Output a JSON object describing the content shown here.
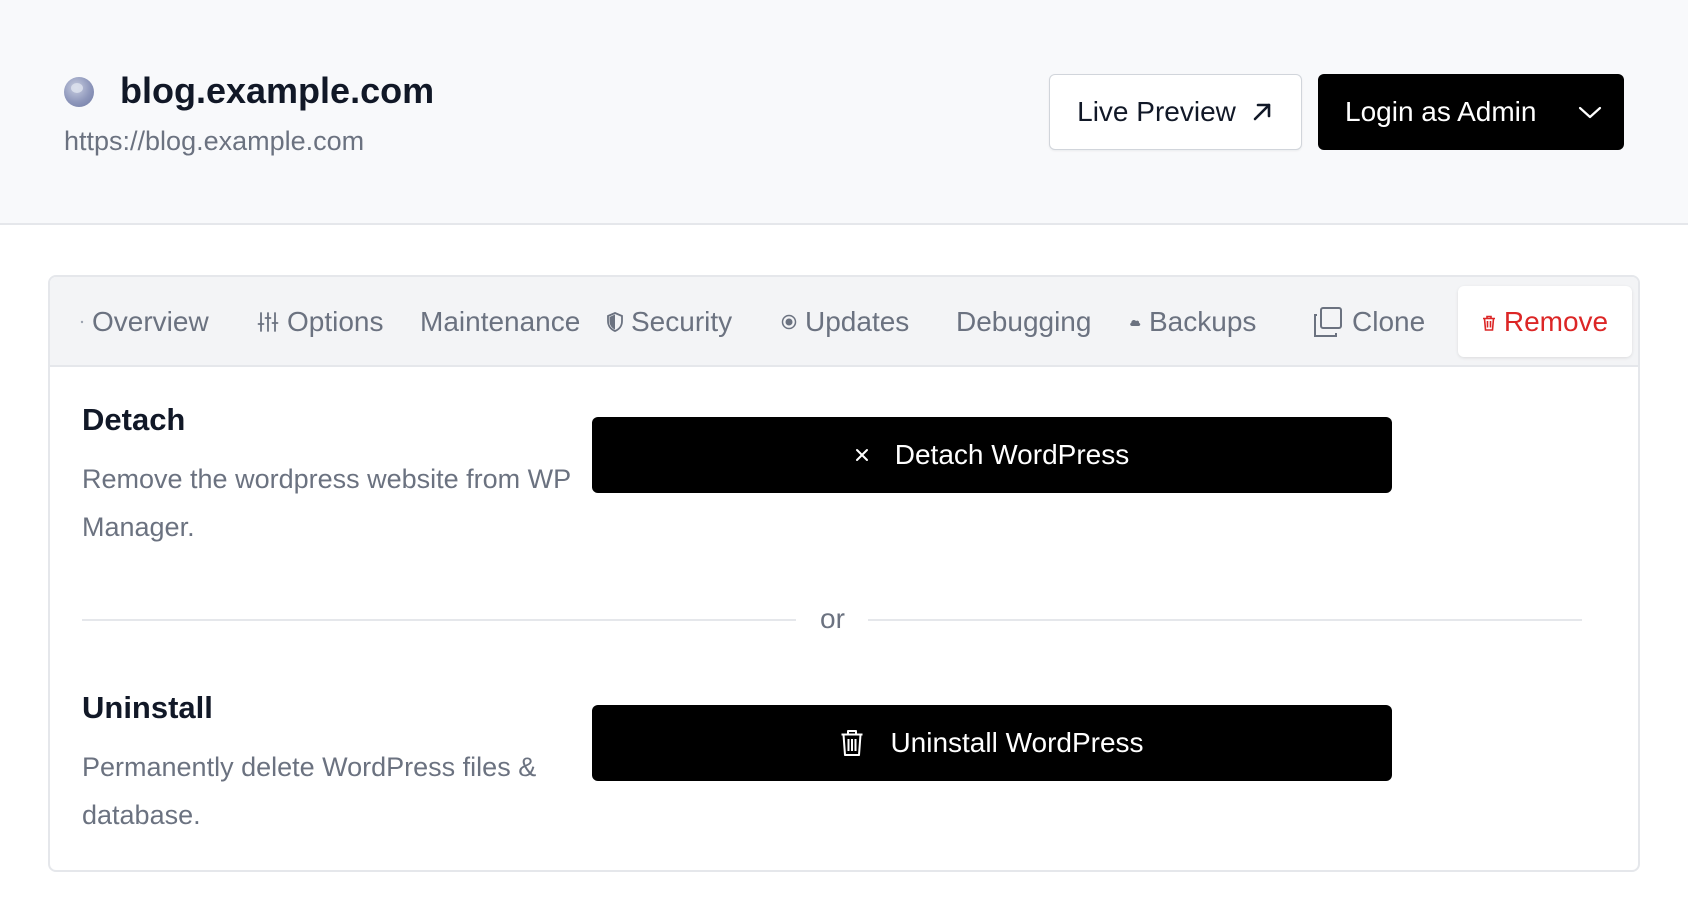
{
  "site": {
    "title": "blog.example.com",
    "url": "https://blog.example.com",
    "icon": "globe-icon"
  },
  "header": {
    "live_preview_label": "Live Preview",
    "live_preview_icon": "external-arrow-icon",
    "login_label": "Login as Admin",
    "login_dropdown_icon": "chevron-down-icon"
  },
  "tabs": [
    {
      "label": "Overview",
      "icon": "dot-icon"
    },
    {
      "label": "Options",
      "icon": "sliders-icon"
    },
    {
      "label": "Maintenance",
      "icon": ""
    },
    {
      "label": "Security",
      "icon": "shield-icon"
    },
    {
      "label": "Updates",
      "icon": "radio-icon"
    },
    {
      "label": "Debugging",
      "icon": ""
    },
    {
      "label": "Backups",
      "icon": "cloud-icon"
    },
    {
      "label": "Clone",
      "icon": "copy-icon"
    },
    {
      "label": "Remove",
      "icon": "trash-icon",
      "active": true
    }
  ],
  "detach": {
    "title": "Detach",
    "description": "Remove the wordpress website from WP Manager.",
    "button_label": "Detach WordPress",
    "button_icon": "close-icon"
  },
  "divider_text": "or",
  "uninstall": {
    "title": "Uninstall",
    "description": "Permanently delete WordPress files & database.",
    "button_label": "Uninstall WordPress",
    "button_icon": "trash-icon"
  },
  "colors": {
    "accent": "#000000",
    "danger": "#dc2626",
    "header_bg": "#f8f9fb",
    "tab_bg": "#f3f4f6",
    "muted_text": "#6b7280"
  }
}
